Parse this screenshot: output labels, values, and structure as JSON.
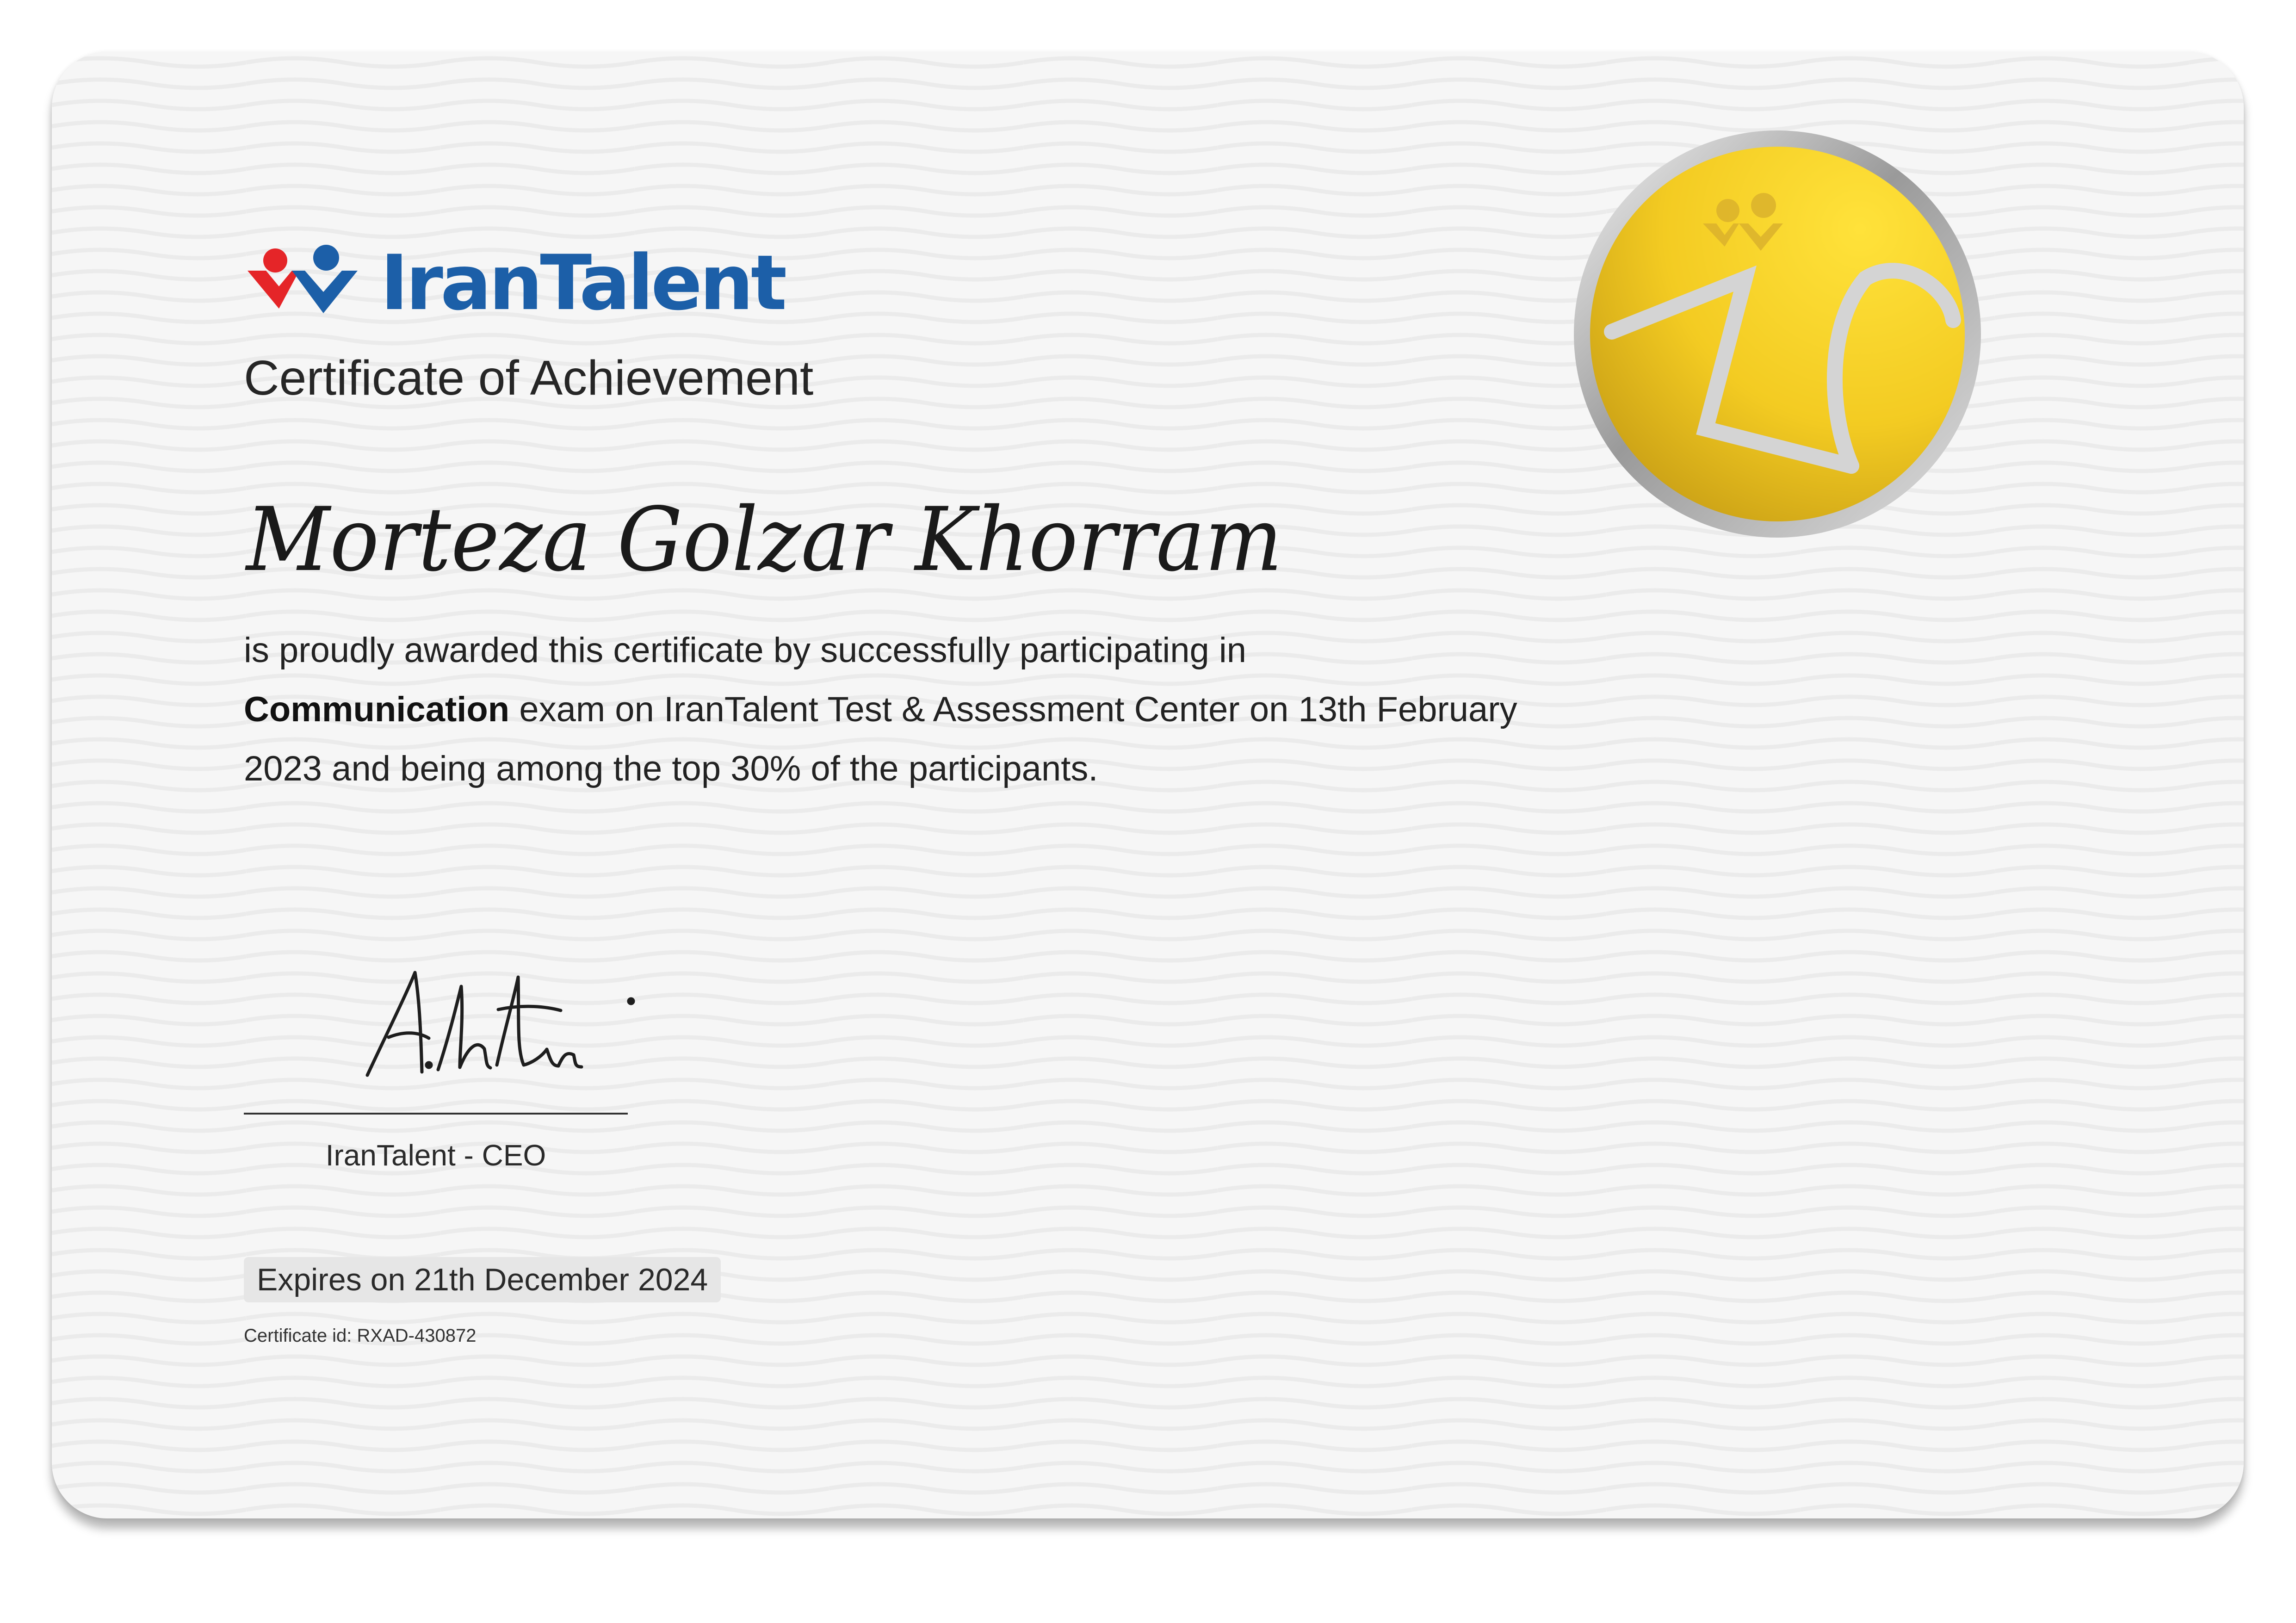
{
  "brand": {
    "name": "IranTalent",
    "color_blue": "#1c5fa8",
    "color_red": "#e52528"
  },
  "certificate": {
    "title": "Certificate of Achievement",
    "recipient": "Morteza Golzar Khorram",
    "body": {
      "line1": "is proudly awarded this certificate by successfully participating in",
      "exam": "Communication",
      "line2": " exam on IranTalent Test & Assessment Center on 13th February 2023 and being among the top 30% of the participants."
    },
    "signatory": "IranTalent - CEO",
    "expiry": "Expires on 21th December 2024",
    "certificate_id": "Certificate id: RXAD-430872"
  },
  "medal": {
    "icon": "gold-medal-icon",
    "gold": "#e8c21a",
    "silver": "#c9c9c9"
  }
}
